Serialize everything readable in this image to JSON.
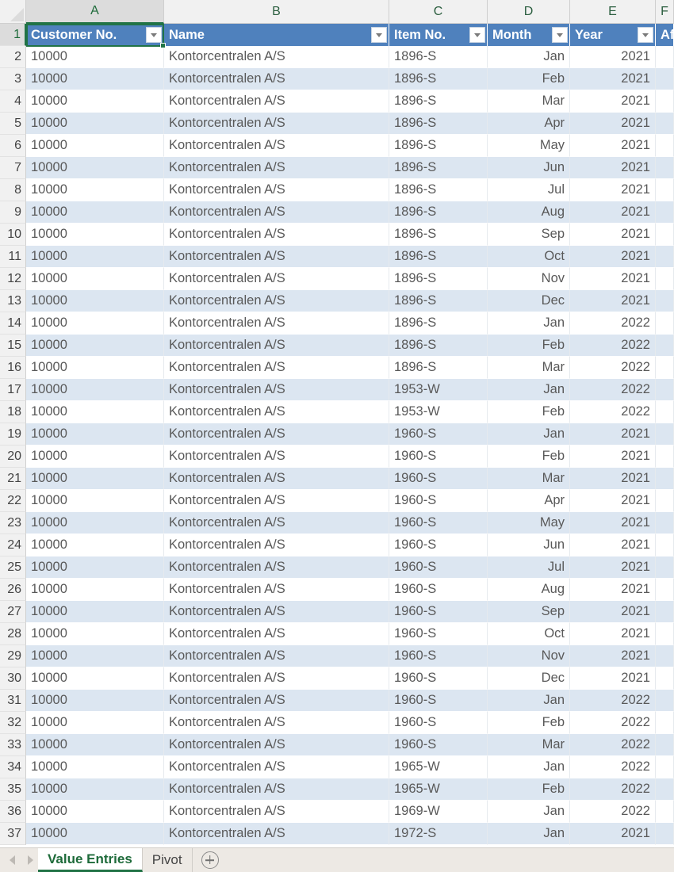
{
  "app": {
    "selected_cell": "A1",
    "colors": {
      "table_header_blue": "#4F81BD",
      "band_stripe": "#DCE6F1",
      "selection_green": "#217346",
      "error_triangle_green": "#1E8E3E",
      "tabbar_background": "#EDE9E4",
      "header_strip": "#F1F1F1"
    }
  },
  "columns": {
    "letters": [
      "A",
      "B",
      "C",
      "D",
      "E",
      "F"
    ],
    "widths": [
      174,
      284,
      124,
      104,
      108,
      23
    ],
    "selected_letter": "A"
  },
  "table": {
    "headers": [
      {
        "label": "Customer No.",
        "align": "left",
        "filter": true
      },
      {
        "label": "Name",
        "align": "left",
        "filter": true
      },
      {
        "label": "Item No.",
        "align": "left",
        "filter": true
      },
      {
        "label": "Month",
        "align": "left",
        "filter": true
      },
      {
        "label": "Year",
        "align": "left",
        "filter": true
      },
      {
        "label": "Af",
        "align": "left",
        "filter": false
      }
    ],
    "header_row_number": "1",
    "rows": [
      {
        "n": "2",
        "customer_no": "10000",
        "name": "Kontorcentralen A/S",
        "item_no": "1896-S",
        "month": "Jan",
        "year": "2021"
      },
      {
        "n": "3",
        "customer_no": "10000",
        "name": "Kontorcentralen A/S",
        "item_no": "1896-S",
        "month": "Feb",
        "year": "2021"
      },
      {
        "n": "4",
        "customer_no": "10000",
        "name": "Kontorcentralen A/S",
        "item_no": "1896-S",
        "month": "Mar",
        "year": "2021"
      },
      {
        "n": "5",
        "customer_no": "10000",
        "name": "Kontorcentralen A/S",
        "item_no": "1896-S",
        "month": "Apr",
        "year": "2021"
      },
      {
        "n": "6",
        "customer_no": "10000",
        "name": "Kontorcentralen A/S",
        "item_no": "1896-S",
        "month": "May",
        "year": "2021"
      },
      {
        "n": "7",
        "customer_no": "10000",
        "name": "Kontorcentralen A/S",
        "item_no": "1896-S",
        "month": "Jun",
        "year": "2021"
      },
      {
        "n": "8",
        "customer_no": "10000",
        "name": "Kontorcentralen A/S",
        "item_no": "1896-S",
        "month": "Jul",
        "year": "2021"
      },
      {
        "n": "9",
        "customer_no": "10000",
        "name": "Kontorcentralen A/S",
        "item_no": "1896-S",
        "month": "Aug",
        "year": "2021"
      },
      {
        "n": "10",
        "customer_no": "10000",
        "name": "Kontorcentralen A/S",
        "item_no": "1896-S",
        "month": "Sep",
        "year": "2021"
      },
      {
        "n": "11",
        "customer_no": "10000",
        "name": "Kontorcentralen A/S",
        "item_no": "1896-S",
        "month": "Oct",
        "year": "2021"
      },
      {
        "n": "12",
        "customer_no": "10000",
        "name": "Kontorcentralen A/S",
        "item_no": "1896-S",
        "month": "Nov",
        "year": "2021"
      },
      {
        "n": "13",
        "customer_no": "10000",
        "name": "Kontorcentralen A/S",
        "item_no": "1896-S",
        "month": "Dec",
        "year": "2021"
      },
      {
        "n": "14",
        "customer_no": "10000",
        "name": "Kontorcentralen A/S",
        "item_no": "1896-S",
        "month": "Jan",
        "year": "2022"
      },
      {
        "n": "15",
        "customer_no": "10000",
        "name": "Kontorcentralen A/S",
        "item_no": "1896-S",
        "month": "Feb",
        "year": "2022"
      },
      {
        "n": "16",
        "customer_no": "10000",
        "name": "Kontorcentralen A/S",
        "item_no": "1896-S",
        "month": "Mar",
        "year": "2022"
      },
      {
        "n": "17",
        "customer_no": "10000",
        "name": "Kontorcentralen A/S",
        "item_no": "1953-W",
        "month": "Jan",
        "year": "2022"
      },
      {
        "n": "18",
        "customer_no": "10000",
        "name": "Kontorcentralen A/S",
        "item_no": "1953-W",
        "month": "Feb",
        "year": "2022"
      },
      {
        "n": "19",
        "customer_no": "10000",
        "name": "Kontorcentralen A/S",
        "item_no": "1960-S",
        "month": "Jan",
        "year": "2021"
      },
      {
        "n": "20",
        "customer_no": "10000",
        "name": "Kontorcentralen A/S",
        "item_no": "1960-S",
        "month": "Feb",
        "year": "2021"
      },
      {
        "n": "21",
        "customer_no": "10000",
        "name": "Kontorcentralen A/S",
        "item_no": "1960-S",
        "month": "Mar",
        "year": "2021"
      },
      {
        "n": "22",
        "customer_no": "10000",
        "name": "Kontorcentralen A/S",
        "item_no": "1960-S",
        "month": "Apr",
        "year": "2021"
      },
      {
        "n": "23",
        "customer_no": "10000",
        "name": "Kontorcentralen A/S",
        "item_no": "1960-S",
        "month": "May",
        "year": "2021"
      },
      {
        "n": "24",
        "customer_no": "10000",
        "name": "Kontorcentralen A/S",
        "item_no": "1960-S",
        "month": "Jun",
        "year": "2021"
      },
      {
        "n": "25",
        "customer_no": "10000",
        "name": "Kontorcentralen A/S",
        "item_no": "1960-S",
        "month": "Jul",
        "year": "2021"
      },
      {
        "n": "26",
        "customer_no": "10000",
        "name": "Kontorcentralen A/S",
        "item_no": "1960-S",
        "month": "Aug",
        "year": "2021"
      },
      {
        "n": "27",
        "customer_no": "10000",
        "name": "Kontorcentralen A/S",
        "item_no": "1960-S",
        "month": "Sep",
        "year": "2021"
      },
      {
        "n": "28",
        "customer_no": "10000",
        "name": "Kontorcentralen A/S",
        "item_no": "1960-S",
        "month": "Oct",
        "year": "2021"
      },
      {
        "n": "29",
        "customer_no": "10000",
        "name": "Kontorcentralen A/S",
        "item_no": "1960-S",
        "month": "Nov",
        "year": "2021"
      },
      {
        "n": "30",
        "customer_no": "10000",
        "name": "Kontorcentralen A/S",
        "item_no": "1960-S",
        "month": "Dec",
        "year": "2021"
      },
      {
        "n": "31",
        "customer_no": "10000",
        "name": "Kontorcentralen A/S",
        "item_no": "1960-S",
        "month": "Jan",
        "year": "2022"
      },
      {
        "n": "32",
        "customer_no": "10000",
        "name": "Kontorcentralen A/S",
        "item_no": "1960-S",
        "month": "Feb",
        "year": "2022"
      },
      {
        "n": "33",
        "customer_no": "10000",
        "name": "Kontorcentralen A/S",
        "item_no": "1960-S",
        "month": "Mar",
        "year": "2022"
      },
      {
        "n": "34",
        "customer_no": "10000",
        "name": "Kontorcentralen A/S",
        "item_no": "1965-W",
        "month": "Jan",
        "year": "2022"
      },
      {
        "n": "35",
        "customer_no": "10000",
        "name": "Kontorcentralen A/S",
        "item_no": "1965-W",
        "month": "Feb",
        "year": "2022"
      },
      {
        "n": "36",
        "customer_no": "10000",
        "name": "Kontorcentralen A/S",
        "item_no": "1969-W",
        "month": "Jan",
        "year": "2022"
      },
      {
        "n": "37",
        "customer_no": "10000",
        "name": "Kontorcentralen A/S",
        "item_no": "1972-S",
        "month": "Jan",
        "year": "2021"
      }
    ]
  },
  "tabbar": {
    "prev_icon": "nav-left-icon",
    "next_icon": "nav-right-icon",
    "sheets": [
      {
        "label": "Value Entries",
        "active": true
      },
      {
        "label": "Pivot",
        "active": false
      }
    ],
    "add_sheet_icon": "plus-circle-icon"
  }
}
